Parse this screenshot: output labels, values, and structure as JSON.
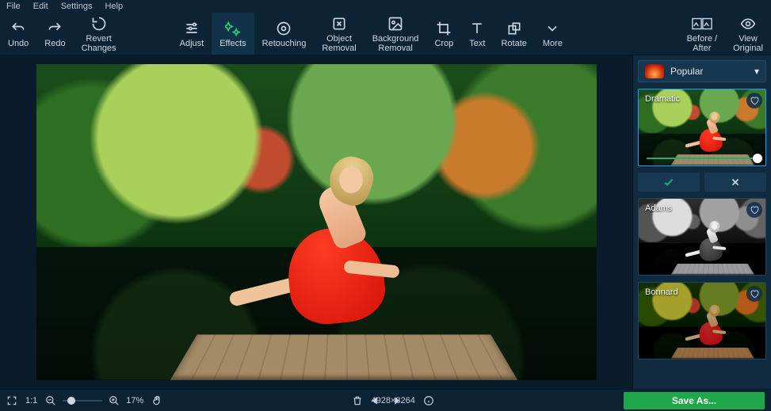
{
  "menu": {
    "file": "File",
    "edit": "Edit",
    "settings": "Settings",
    "help": "Help"
  },
  "toolbar": {
    "undo": "Undo",
    "redo": "Redo",
    "revert": "Revert\nChanges",
    "adjust": "Adjust",
    "effects": "Effects",
    "retouching": "Retouching",
    "object_removal": "Object\nRemoval",
    "background_removal": "Background\nRemoval",
    "crop": "Crop",
    "text": "Text",
    "rotate": "Rotate",
    "more": "More",
    "before_after": "Before /\nAfter",
    "view_original": "View\nOriginal"
  },
  "effects_panel": {
    "category": "Popular",
    "presets": [
      {
        "name": "Dramatic",
        "selected": true
      },
      {
        "name": "Adams"
      },
      {
        "name": "Bonnard"
      }
    ]
  },
  "status": {
    "fit": "1:1",
    "zoom_pct": "17%",
    "dimensions": "4928×3264",
    "save": "Save As..."
  }
}
